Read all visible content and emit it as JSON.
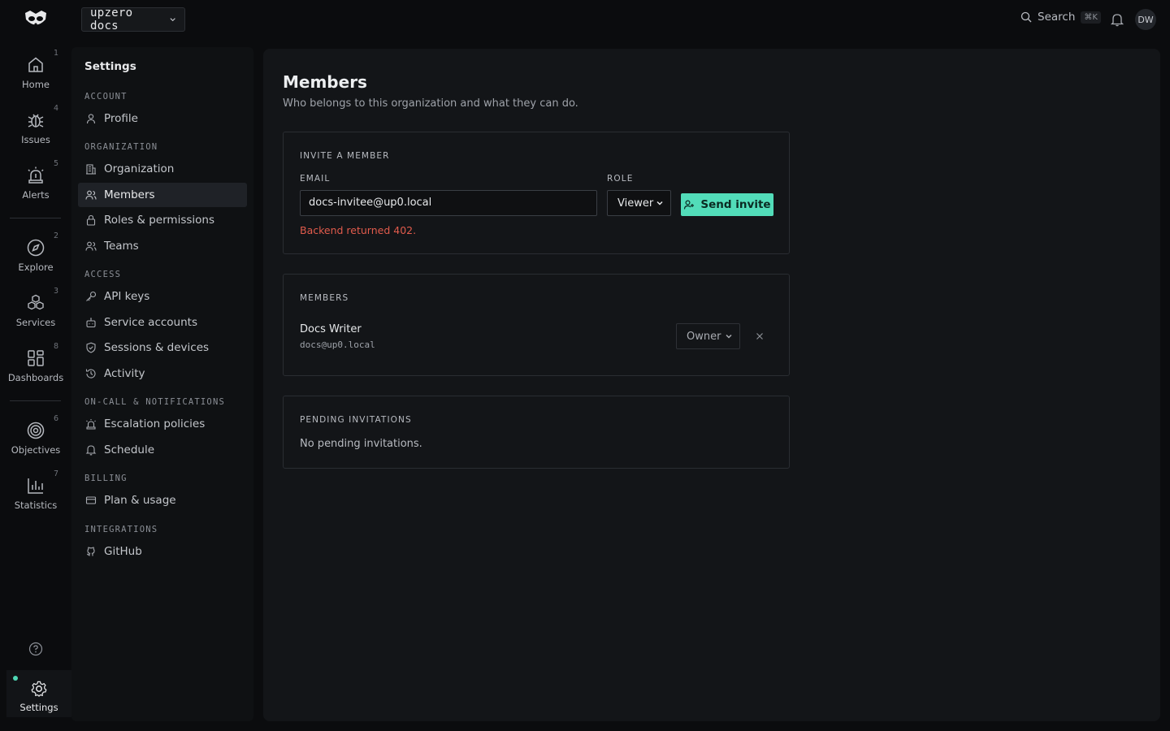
{
  "topbar": {
    "org_name": "upzero docs",
    "search_label": "Search",
    "search_shortcut": "⌘K",
    "avatar_initials": "DW"
  },
  "rail": {
    "items": [
      {
        "label": "Home",
        "num": "1",
        "icon": "home-icon"
      },
      {
        "label": "Issues",
        "num": "4",
        "icon": "bug-icon"
      },
      {
        "label": "Alerts",
        "num": "5",
        "icon": "siren-icon"
      },
      {
        "label": "Explore",
        "num": "2",
        "icon": "compass-icon"
      },
      {
        "label": "Services",
        "num": "3",
        "icon": "boxes-icon"
      },
      {
        "label": "Dashboards",
        "num": "8",
        "icon": "grid-icon"
      },
      {
        "label": "Objectives",
        "num": "6",
        "icon": "target-icon"
      },
      {
        "label": "Statistics",
        "num": "7",
        "icon": "bar-chart-icon"
      }
    ],
    "settings_label": "Settings"
  },
  "sidebar": {
    "title": "Settings",
    "groups": {
      "account": "ACCOUNT",
      "organization": "ORGANIZATION",
      "access": "ACCESS",
      "oncall": "ON-CALL & NOTIFICATIONS",
      "billing": "BILLING",
      "integrations": "INTEGRATIONS"
    },
    "items": {
      "profile": "Profile",
      "organization": "Organization",
      "members": "Members",
      "roles": "Roles & permissions",
      "teams": "Teams",
      "api_keys": "API keys",
      "service_accounts": "Service accounts",
      "sessions": "Sessions & devices",
      "activity": "Activity",
      "escalation": "Escalation policies",
      "schedule": "Schedule",
      "plan": "Plan & usage",
      "github": "GitHub"
    }
  },
  "main": {
    "title": "Members",
    "subtitle": "Who belongs to this organization and what they can do.",
    "invite": {
      "heading": "INVITE A MEMBER",
      "email_label": "EMAIL",
      "email_value": "docs-invitee@up0.local",
      "role_label": "ROLE",
      "role_value": "Viewer",
      "send_label": "Send invite",
      "error": "Backend returned 402."
    },
    "members": {
      "heading": "MEMBERS",
      "rows": [
        {
          "name": "Docs Writer",
          "email": "docs@up0.local",
          "role": "Owner"
        }
      ]
    },
    "pending": {
      "heading": "PENDING INVITATIONS",
      "empty": "No pending invitations."
    }
  },
  "colors": {
    "accent": "#52dcb9",
    "error": "#e15b4c",
    "background": "#0b0c0e",
    "panel": "#131518"
  }
}
